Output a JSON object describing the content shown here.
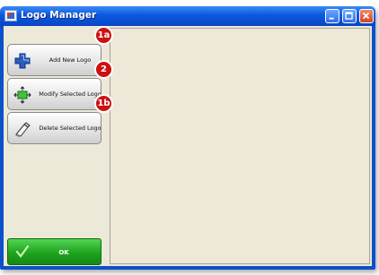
{
  "window": {
    "title": "Logo Manager"
  },
  "buttons": {
    "add": "Add New Logo",
    "modify": "Modify Selected Logo",
    "delete": "Delete Selected Logo",
    "ok": "OK"
  },
  "badges": {
    "add": "1a",
    "modify": "2",
    "delete": "1b"
  },
  "icons": {
    "add": "blue-plus-icon",
    "modify": "green-resize-icon",
    "delete": "eraser-icon",
    "ok": "checkmark-icon"
  },
  "colors": {
    "title_bar": "#0b58e0",
    "ok_button": "#1ea41e",
    "badge": "#cc1111"
  }
}
